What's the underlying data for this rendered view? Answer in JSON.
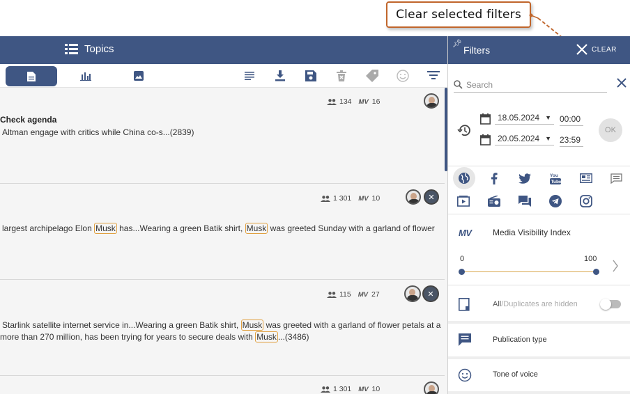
{
  "callout": {
    "text": "Clear selected filters"
  },
  "header": {
    "topics_label": "Topics"
  },
  "cards": [
    {
      "audience": "134",
      "mv": "16",
      "title": "Check agenda",
      "line1": "Altman engage with critics while China co-s...(2839)"
    },
    {
      "audience": "1 301",
      "mv": "10",
      "line1_a": "largest archipelago Elon ",
      "hl1": "Musk",
      "line1_b": " has...Wearing a green Batik shirt, ",
      "hl2": "Musk",
      "line1_c": " was greeted Sunday with a garland of flower"
    },
    {
      "audience": "115",
      "mv": "27",
      "line1_a": "Starlink satellite internet service in...Wearing a green Batik shirt, ",
      "hl1": "Musk",
      "line1_b": " was greeted with a garland of flower petals at a",
      "line2_a": "more than 270 million, has been trying for years to secure deals with ",
      "hl2": "Musk",
      "line2_b": "...(3486)"
    },
    {
      "audience": "1 301",
      "mv": "10"
    }
  ],
  "mv_label": "MV",
  "filters": {
    "title": "Filters",
    "clear_label": "CLEAR",
    "search_placeholder": "Search",
    "date_from": "18.05.2024",
    "time_from": "00:00",
    "date_to": "20.05.2024",
    "time_to": "23:59",
    "ok_label": "OK",
    "mvi_abbr": "MV",
    "mvi_label": "Media Visibility Index",
    "slider_min": "0",
    "slider_max": "100",
    "dup_all": "All",
    "dup_rest": "/Duplicates are hidden",
    "publication_type": "Publication type",
    "tone_of_voice": "Tone of voice"
  },
  "colors": {
    "brand": "#3f5683",
    "accent": "#c0652b",
    "highlight": "#e0a040"
  }
}
